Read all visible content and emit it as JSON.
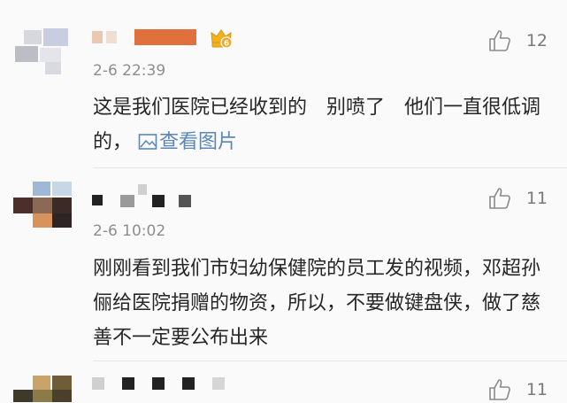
{
  "comments": [
    {
      "time": "2-6 22:39",
      "text": "这是我们医院已经收到的　别喷了　他们一直很低调的，",
      "link": "查看图片",
      "likes": "12",
      "icons": [
        "avatar",
        "vip-crown-icon",
        "picture-icon",
        "thumbs-up-icon"
      ]
    },
    {
      "time": "2-6 10:02",
      "text": "刚刚看到我们市妇幼保健院的员工发的视频，邓超孙俪给医院捐赠的物资，所以，不要做键盘侠，做了慈善不一定要公布出来",
      "likes": "11",
      "icons": [
        "avatar",
        "thumbs-up-icon"
      ]
    },
    {
      "likes": "11",
      "icons": [
        "avatar",
        "thumbs-up-icon"
      ]
    }
  ]
}
